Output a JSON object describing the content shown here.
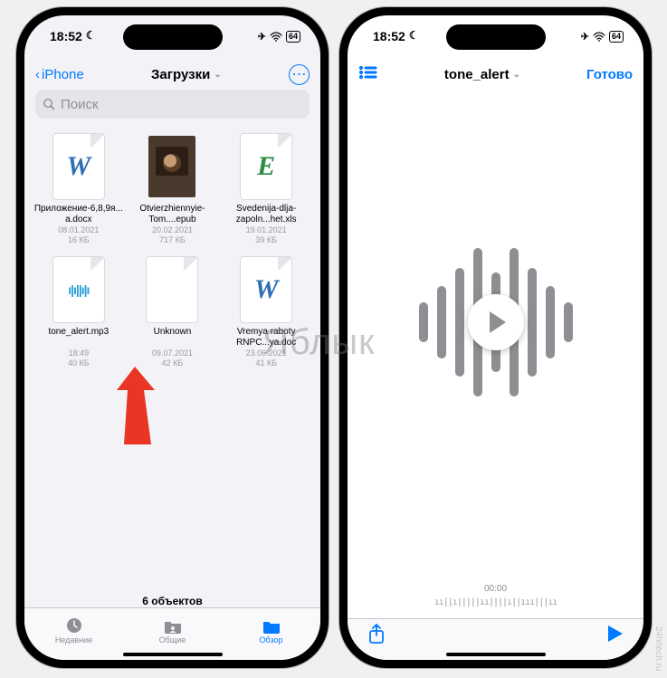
{
  "status": {
    "time": "18:52",
    "battery": "64"
  },
  "watermark_center": "Яблык",
  "watermark_side": "24hitech.ru",
  "left": {
    "back_label": "iPhone",
    "title": "Загрузки",
    "search_placeholder": "Поиск",
    "files": [
      {
        "name": "Приложение-6,8,9я...a.docx",
        "date": "08.01.2021",
        "size": "16 КБ",
        "kind": "word"
      },
      {
        "name": "Otvierzhiennyie-Tom....epub",
        "date": "20.02.2021",
        "size": "717 КБ",
        "kind": "epub"
      },
      {
        "name": "Svedenija-dlja-zapoln...het.xls",
        "date": "19.01.2021",
        "size": "39 КБ",
        "kind": "excel"
      },
      {
        "name": "tone_alert.mp3",
        "date": "18:49",
        "size": "40 КБ",
        "kind": "audio"
      },
      {
        "name": "Unknown",
        "date": "09.07.2021",
        "size": "42 КБ",
        "kind": "blank"
      },
      {
        "name": "Vremya raboty RNPC...ya.doc",
        "date": "23.06.2021",
        "size": "41 КБ",
        "kind": "word"
      }
    ],
    "summary": "6 объектов",
    "tabs": {
      "recent": "Недавние",
      "shared": "Общие",
      "browse": "Обзор"
    }
  },
  "right": {
    "title": "tone_alert",
    "done": "Готово",
    "time_display": "00:00"
  }
}
